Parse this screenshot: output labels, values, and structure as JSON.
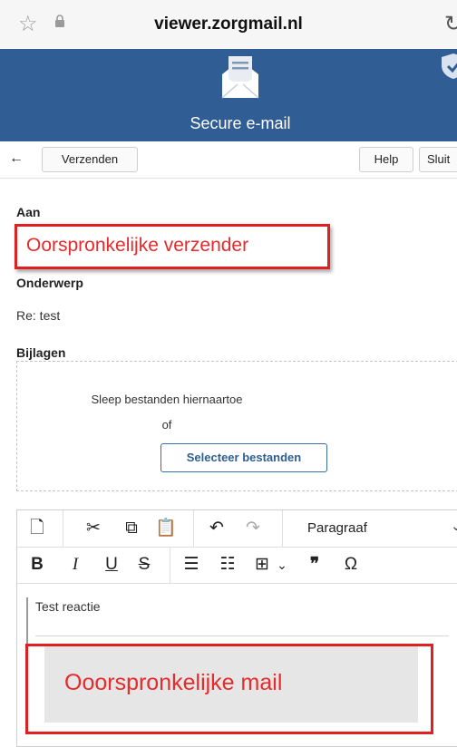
{
  "browser": {
    "url": "viewer.zorgmail.nl"
  },
  "banner": {
    "title": "Secure e-mail"
  },
  "toolbar": {
    "back": "←",
    "send": "Verzenden",
    "help": "Help",
    "close": "Sluit"
  },
  "form": {
    "to_label": "Aan",
    "to_value": "Oorspronkelijke verzender",
    "subject_label": "Onderwerp",
    "subject_value": "Re: test",
    "attachments_label": "Bijlagen",
    "drop_text": "Sleep bestanden hiernaartoe",
    "or_text": "of",
    "select_button": "Selecteer bestanden"
  },
  "editor": {
    "paragraph_format": "Paragraaf",
    "body_text": "Test reactie",
    "quoted_mail": "Ooorspronkelijke mail",
    "toolbar_row1": [
      "new-doc-icon",
      "cut-icon",
      "copy-icon",
      "paste-icon",
      "undo-icon",
      "redo-icon"
    ],
    "toolbar_row2": [
      "bold-icon",
      "italic-icon",
      "underline-icon",
      "strikethrough-icon",
      "bullet-list-icon",
      "numbered-list-icon",
      "table-icon",
      "quote-icon",
      "omega-icon"
    ]
  },
  "colors": {
    "banner": "#2f5d94",
    "annotation": "#e02020",
    "button_text": "#2d5f93"
  }
}
